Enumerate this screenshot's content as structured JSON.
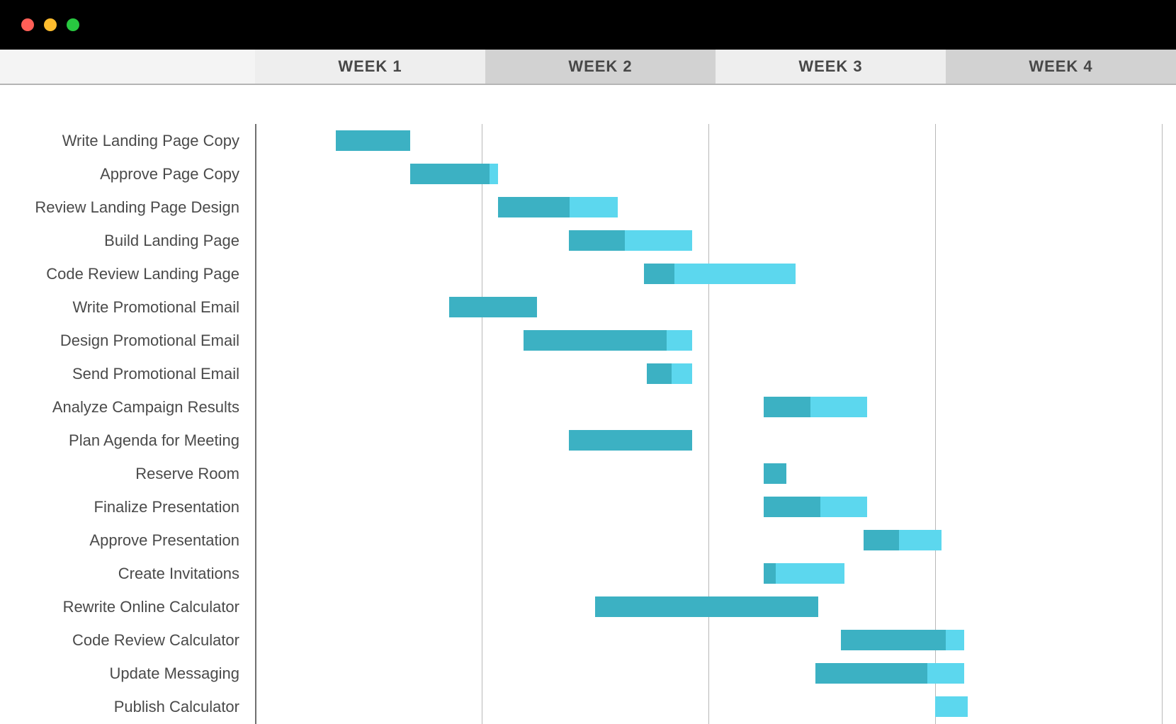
{
  "window": {
    "traffic_lights": [
      "close",
      "minimize",
      "zoom"
    ]
  },
  "weeks": [
    "WEEK 1",
    "WEEK 2",
    "WEEK 3",
    "WEEK 4"
  ],
  "chart_data": {
    "type": "gantt",
    "title": "",
    "xlabel": "",
    "ylabel": "",
    "x_unit": "days",
    "x_range": [
      0,
      28
    ],
    "week_boundaries": [
      0,
      7,
      14,
      21,
      28
    ],
    "row_height_days_equivalent": null,
    "colors": {
      "complete": "#3cb1c3",
      "remaining": "#5cd7ee"
    },
    "series_note": "Each bar has a darker left segment (progress complete) and a lighter right segment (remaining).",
    "tasks": [
      {
        "label": "Write Landing Page Copy",
        "start": 2.5,
        "end": 4.8,
        "progress": 1.0
      },
      {
        "label": "Approve Page Copy",
        "start": 4.8,
        "end": 7.5,
        "progress": 0.9
      },
      {
        "label": "Review Landing Page Design",
        "start": 7.5,
        "end": 11.2,
        "progress": 0.6
      },
      {
        "label": "Build Landing Page",
        "start": 9.7,
        "end": 13.5,
        "progress": 0.45
      },
      {
        "label": "Code Review Landing Page",
        "start": 12.0,
        "end": 16.7,
        "progress": 0.2
      },
      {
        "label": "Write Promotional Email",
        "start": 6.0,
        "end": 8.7,
        "progress": 1.0
      },
      {
        "label": "Design Promotional Email",
        "start": 8.3,
        "end": 13.5,
        "progress": 0.85
      },
      {
        "label": "Send Promotional Email",
        "start": 12.1,
        "end": 13.5,
        "progress": 0.55
      },
      {
        "label": "Analyze Campaign Results",
        "start": 15.7,
        "end": 18.9,
        "progress": 0.45
      },
      {
        "label": "Plan Agenda for Meeting",
        "start": 9.7,
        "end": 13.5,
        "progress": 1.0
      },
      {
        "label": "Reserve Room",
        "start": 15.7,
        "end": 16.4,
        "progress": 1.0
      },
      {
        "label": "Finalize Presentation",
        "start": 15.7,
        "end": 18.9,
        "progress": 0.55
      },
      {
        "label": "Approve Presentation",
        "start": 18.8,
        "end": 21.2,
        "progress": 0.45
      },
      {
        "label": "Create Invitations",
        "start": 15.7,
        "end": 18.2,
        "progress": 0.15
      },
      {
        "label": "Rewrite Online Calculator",
        "start": 10.5,
        "end": 17.4,
        "progress": 1.0
      },
      {
        "label": "Code Review Calculator",
        "start": 18.1,
        "end": 21.9,
        "progress": 0.85
      },
      {
        "label": "Update Messaging",
        "start": 17.3,
        "end": 21.9,
        "progress": 0.75
      },
      {
        "label": "Publish Calculator",
        "start": 21.0,
        "end": 22.0,
        "progress": 0.0
      }
    ]
  }
}
